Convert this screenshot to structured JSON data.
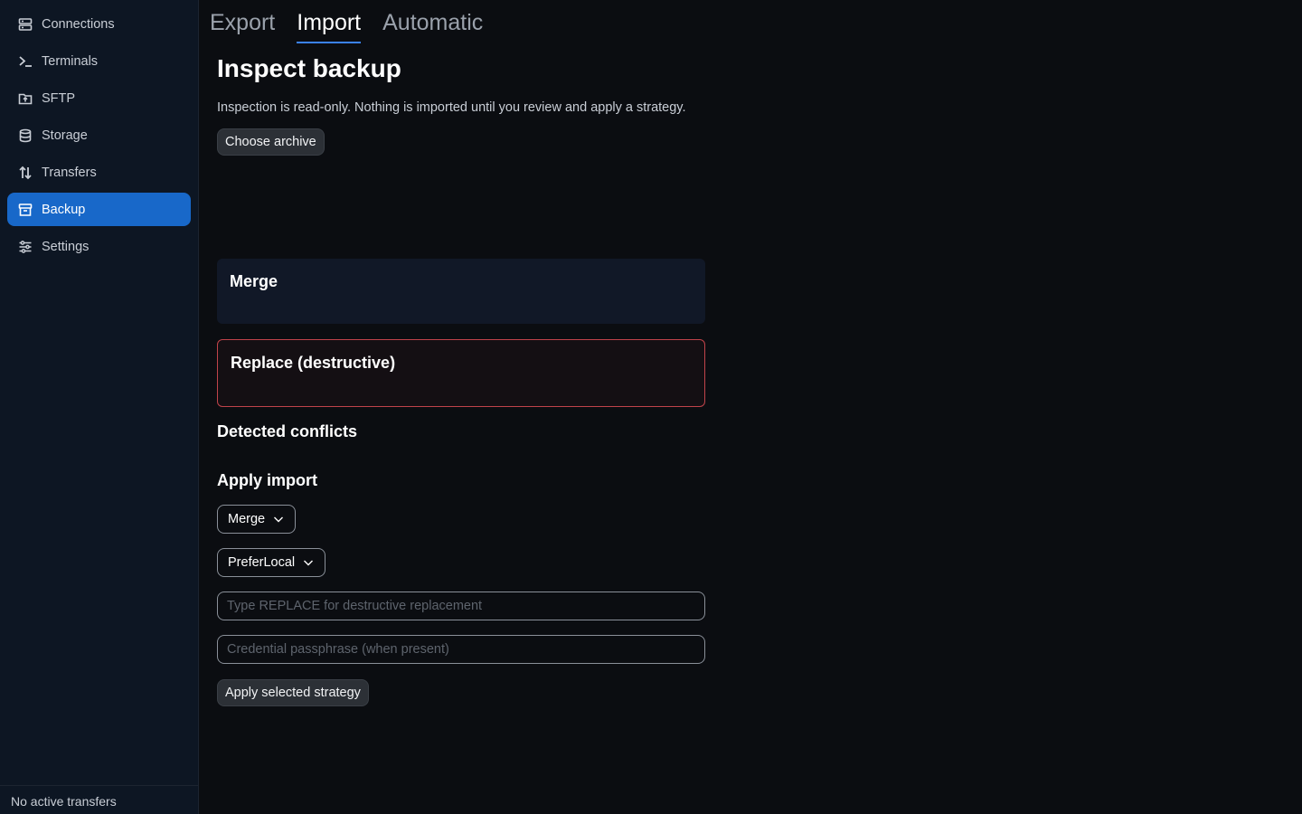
{
  "sidebar": {
    "items": [
      {
        "label": "Connections",
        "icon": "server-icon"
      },
      {
        "label": "Terminals",
        "icon": "terminal-icon"
      },
      {
        "label": "SFTP",
        "icon": "folder-upload-icon"
      },
      {
        "label": "Storage",
        "icon": "database-icon"
      },
      {
        "label": "Transfers",
        "icon": "arrows-up-down-icon"
      },
      {
        "label": "Backup",
        "icon": "archive-icon",
        "active": true
      },
      {
        "label": "Settings",
        "icon": "sliders-icon"
      }
    ],
    "footer": "No active transfers"
  },
  "tabs": [
    {
      "label": "Export"
    },
    {
      "label": "Import",
      "active": true
    },
    {
      "label": "Automatic"
    }
  ],
  "main": {
    "title": "Inspect backup",
    "subtitle": "Inspection is read-only. Nothing is imported until you review and apply a strategy.",
    "choose_label": "Choose archive",
    "merge_card_title": "Merge",
    "replace_card_title": "Replace (destructive)",
    "conflicts_title": "Detected conflicts",
    "apply_title": "Apply import",
    "strategy_value": "Merge",
    "conflict_value": "PreferLocal",
    "replace_placeholder": "Type REPLACE for destructive replacement",
    "passphrase_placeholder": "Credential passphrase (when present)",
    "apply_label": "Apply selected strategy"
  },
  "colors": {
    "accent": "#1868c9",
    "destructive": "#c0434a",
    "background": "#0b0d11",
    "sidebar": "#0d1623"
  }
}
